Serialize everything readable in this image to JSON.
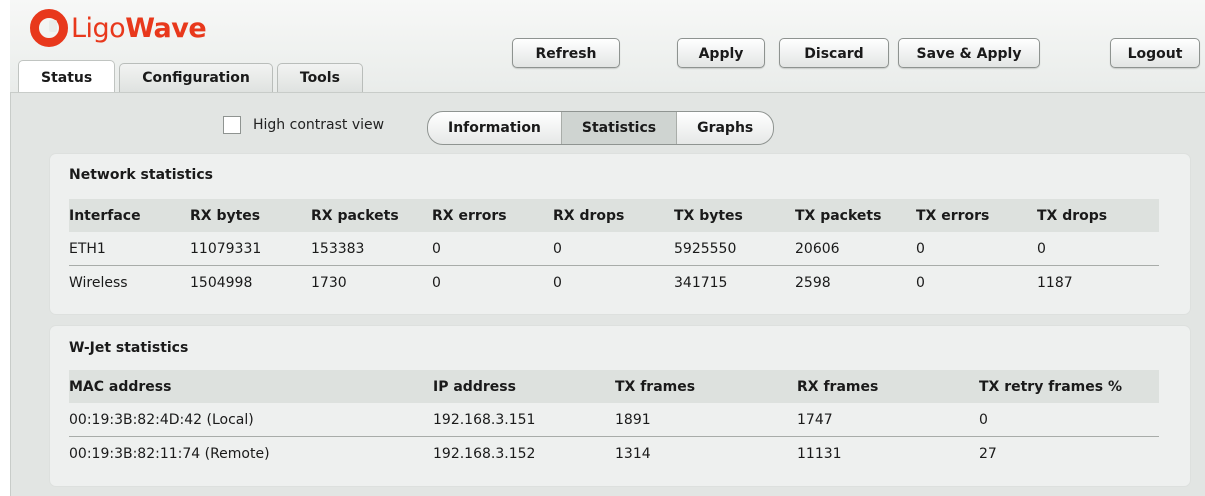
{
  "brand": {
    "name_part1": "Ligo",
    "name_part2": "Wave"
  },
  "tabs": [
    {
      "label": "Status",
      "active": true
    },
    {
      "label": "Configuration",
      "active": false
    },
    {
      "label": "Tools",
      "active": false
    }
  ],
  "toolbar": {
    "refresh": "Refresh",
    "apply": "Apply",
    "discard": "Discard",
    "save_apply": "Save & Apply",
    "logout": "Logout"
  },
  "view": {
    "high_contrast_label": "High contrast view",
    "high_contrast_checked": false,
    "segments": [
      {
        "label": "Information",
        "active": false
      },
      {
        "label": "Statistics",
        "active": true
      },
      {
        "label": "Graphs",
        "active": false
      }
    ]
  },
  "network_statistics": {
    "title": "Network statistics",
    "columns": [
      "Interface",
      "RX bytes",
      "RX packets",
      "RX errors",
      "RX drops",
      "TX bytes",
      "TX packets",
      "TX errors",
      "TX drops"
    ],
    "rows": [
      [
        "ETH1",
        "11079331",
        "153383",
        "0",
        "0",
        "5925550",
        "20606",
        "0",
        "0"
      ],
      [
        "Wireless",
        "1504998",
        "1730",
        "0",
        "0",
        "341715",
        "2598",
        "0",
        "1187"
      ]
    ]
  },
  "wjet_statistics": {
    "title": "W-Jet statistics",
    "columns": [
      "MAC address",
      "IP address",
      "TX frames",
      "RX frames",
      "TX retry frames %"
    ],
    "rows": [
      [
        "00:19:3B:82:4D:42 (Local)",
        "192.168.3.151",
        "1891",
        "1747",
        "0"
      ],
      [
        "00:19:3B:82:11:74 (Remote)",
        "192.168.3.152",
        "1314",
        "11131",
        "27"
      ]
    ]
  },
  "colors": {
    "brand_red": "#e8381c",
    "content_bg": "#e2e5e3",
    "panel_bg": "#eef0ef",
    "header_row_bg": "#dde1de"
  }
}
